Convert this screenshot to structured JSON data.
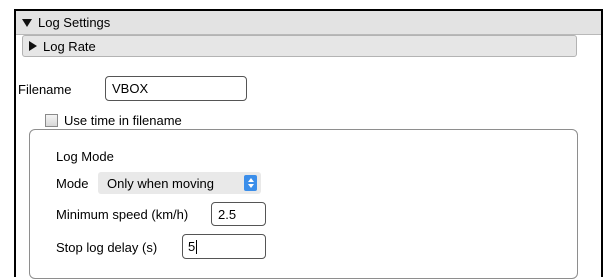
{
  "log_settings": {
    "title": "Log Settings",
    "log_rate_label": "Log Rate",
    "filename_label": "Filename",
    "filename_value": "VBOX",
    "use_time_label": "Use time in filename",
    "use_time_checked": false
  },
  "log_mode": {
    "title": "Log Mode",
    "mode_label": "Mode",
    "mode_value": "Only when moving",
    "min_speed_label": "Minimum speed (km/h)",
    "min_speed_value": "2.5",
    "stop_delay_label": "Stop log delay (s)",
    "stop_delay_value": "5"
  },
  "colors": {
    "header_bg": "#e3e3e3",
    "select_arrow_bg": "#3b8eea"
  },
  "icons": {
    "collapse": "triangle-down-icon",
    "expand": "triangle-right-icon",
    "select": "up-down-arrows-icon"
  }
}
